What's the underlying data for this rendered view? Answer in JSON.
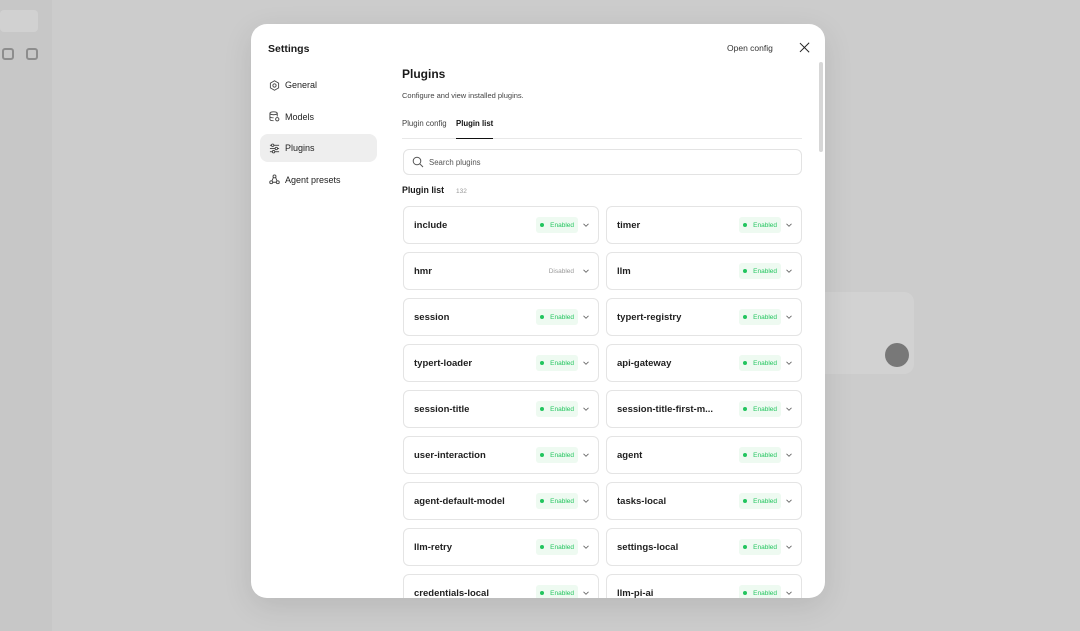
{
  "settings": {
    "title": "Settings",
    "open_config": "Open config"
  },
  "nav": {
    "items": [
      {
        "label": "General",
        "icon": "gear-icon"
      },
      {
        "label": "Models",
        "icon": "database-icon"
      },
      {
        "label": "Plugins",
        "icon": "sliders-icon",
        "active": true
      },
      {
        "label": "Agent presets",
        "icon": "agent-icon"
      }
    ]
  },
  "main": {
    "title": "Plugins",
    "description": "Configure and view installed plugins.",
    "tabs": [
      {
        "label": "Plugin config"
      },
      {
        "label": "Plugin list",
        "active": true
      }
    ],
    "search_placeholder": "Search plugins",
    "list_title": "Plugin list",
    "list_count": "132"
  },
  "plugins": [
    {
      "name": "include",
      "status": "Enabled"
    },
    {
      "name": "timer",
      "status": "Enabled"
    },
    {
      "name": "hmr",
      "status": "Disabled"
    },
    {
      "name": "llm",
      "status": "Enabled"
    },
    {
      "name": "session",
      "status": "Enabled"
    },
    {
      "name": "typert-registry",
      "status": "Enabled"
    },
    {
      "name": "typert-loader",
      "status": "Enabled"
    },
    {
      "name": "api-gateway",
      "status": "Enabled"
    },
    {
      "name": "session-title",
      "status": "Enabled"
    },
    {
      "name": "session-title-first-m...",
      "status": "Enabled"
    },
    {
      "name": "user-interaction",
      "status": "Enabled"
    },
    {
      "name": "agent",
      "status": "Enabled"
    },
    {
      "name": "agent-default-model",
      "status": "Enabled"
    },
    {
      "name": "tasks-local",
      "status": "Enabled"
    },
    {
      "name": "llm-retry",
      "status": "Enabled"
    },
    {
      "name": "settings-local",
      "status": "Enabled"
    },
    {
      "name": "credentials-local",
      "status": "Enabled"
    },
    {
      "name": "llm-pi-ai",
      "status": "Enabled"
    }
  ],
  "colors": {
    "enabled": "#22c55e",
    "enabled_bg": "#eefaf1",
    "disabled": "#9a9a9a",
    "active_nav_bg": "#eeeeee"
  }
}
